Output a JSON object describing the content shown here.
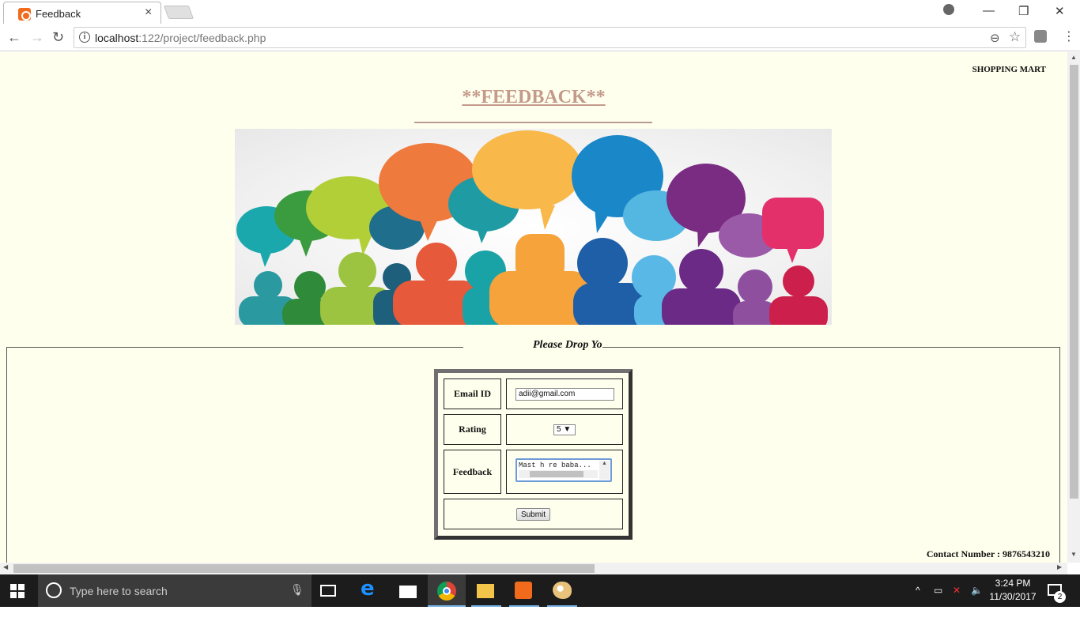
{
  "browser": {
    "tab_title": "Feedback",
    "url_host": "localhost",
    "url_path": ":122/project/feedback.php"
  },
  "page": {
    "brand": "SHOPPING MART",
    "title": "**FEEDBACK**",
    "legend": "Please Drop Your Feedback",
    "contact": "Contact Number : 9876543210",
    "background_color": "#ffffee",
    "title_color": "#c49a8a"
  },
  "form": {
    "email_label": "Email ID",
    "email_value": "adii@gmail.com",
    "rating_label": "Rating",
    "rating_value": "5",
    "feedback_label": "Feedback",
    "feedback_value": "Mast h re baba...",
    "submit_label": "Submit"
  },
  "taskbar": {
    "search_placeholder": "Type here to search",
    "time": "3:24 PM",
    "date": "11/30/2017",
    "notification_count": "2"
  }
}
